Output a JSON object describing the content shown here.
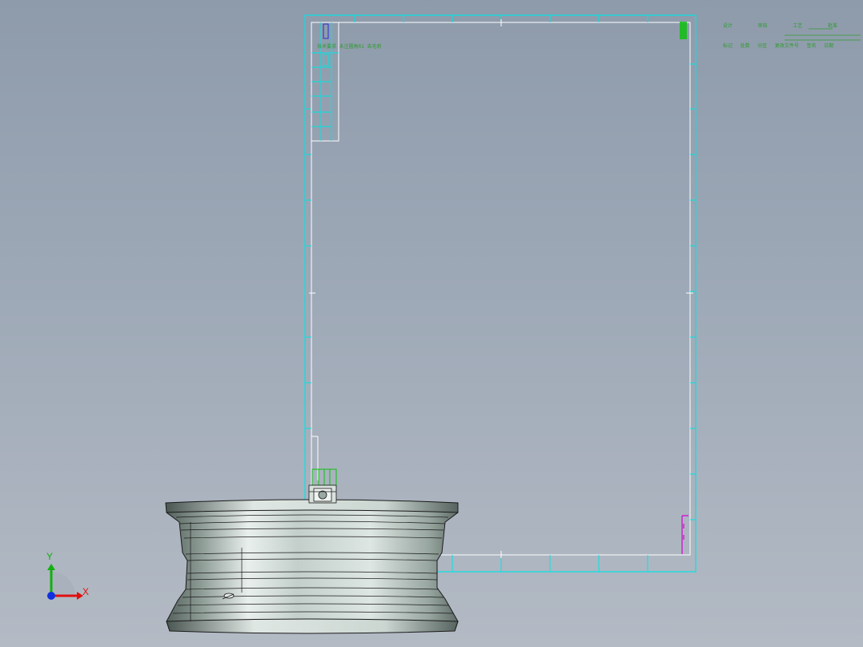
{
  "viewport": {
    "name": "CAD graphics viewport",
    "background_top": "#8e9bab",
    "background_bottom": "#b3bac4"
  },
  "drawing_sheet": {
    "border_color": "#00e5e5",
    "inner_frame_color": "#ffffff",
    "note_color": "#2f9b2f",
    "accent_blue": "#2a2ad8",
    "accent_magenta": "#d400d4"
  },
  "title_block": {
    "row1": [
      "设计",
      "审核",
      "工艺",
      "批准"
    ],
    "row2": [
      "标记",
      "处数",
      "分区",
      "更改文件号",
      "签名",
      "日期"
    ],
    "note": "技术要求 未注圆角R1 去毛刺"
  },
  "model": {
    "part": "wheel-rim",
    "shade_light": "#e9efec",
    "shade_mid": "#b9c6c0",
    "shade_dark": "#55625d",
    "edge_color": "#1a1a1a"
  },
  "triad": {
    "x_label": "X",
    "y_label": "Y",
    "x_color": "#e01010",
    "y_color": "#10b010",
    "z_color": "#1030e0"
  }
}
